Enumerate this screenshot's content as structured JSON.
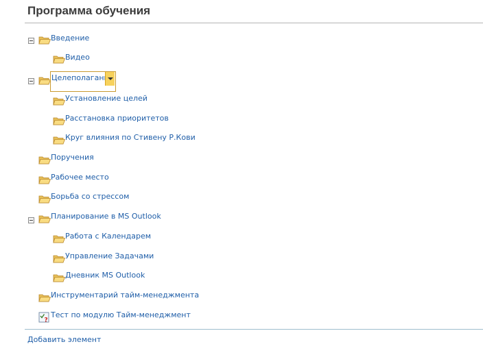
{
  "header": {
    "title": "Программа обучения"
  },
  "tree": {
    "intro": "Введение",
    "video": "Видео",
    "goal_setting": "Целеполагание",
    "set_goals": "Установление целей",
    "priorities": "Расстановка приоритетов",
    "covey_circle": "Круг влияния по Стивену Р.Кови",
    "assignments": "Поручения",
    "workplace": "Рабочее место",
    "stress": "Борьба со стрессом",
    "outlook_planning": "Планирование в MS Outlook",
    "calendar": "Работа с Календарем",
    "tasks": "Управление Задачами",
    "journal": "Дневник MS Outlook",
    "toolkit": "Инструментарий тайм-менеджмента",
    "test": "Тест по модулю Тайм-менеджмент"
  },
  "footer": {
    "add_item": "Добавить элемент"
  }
}
